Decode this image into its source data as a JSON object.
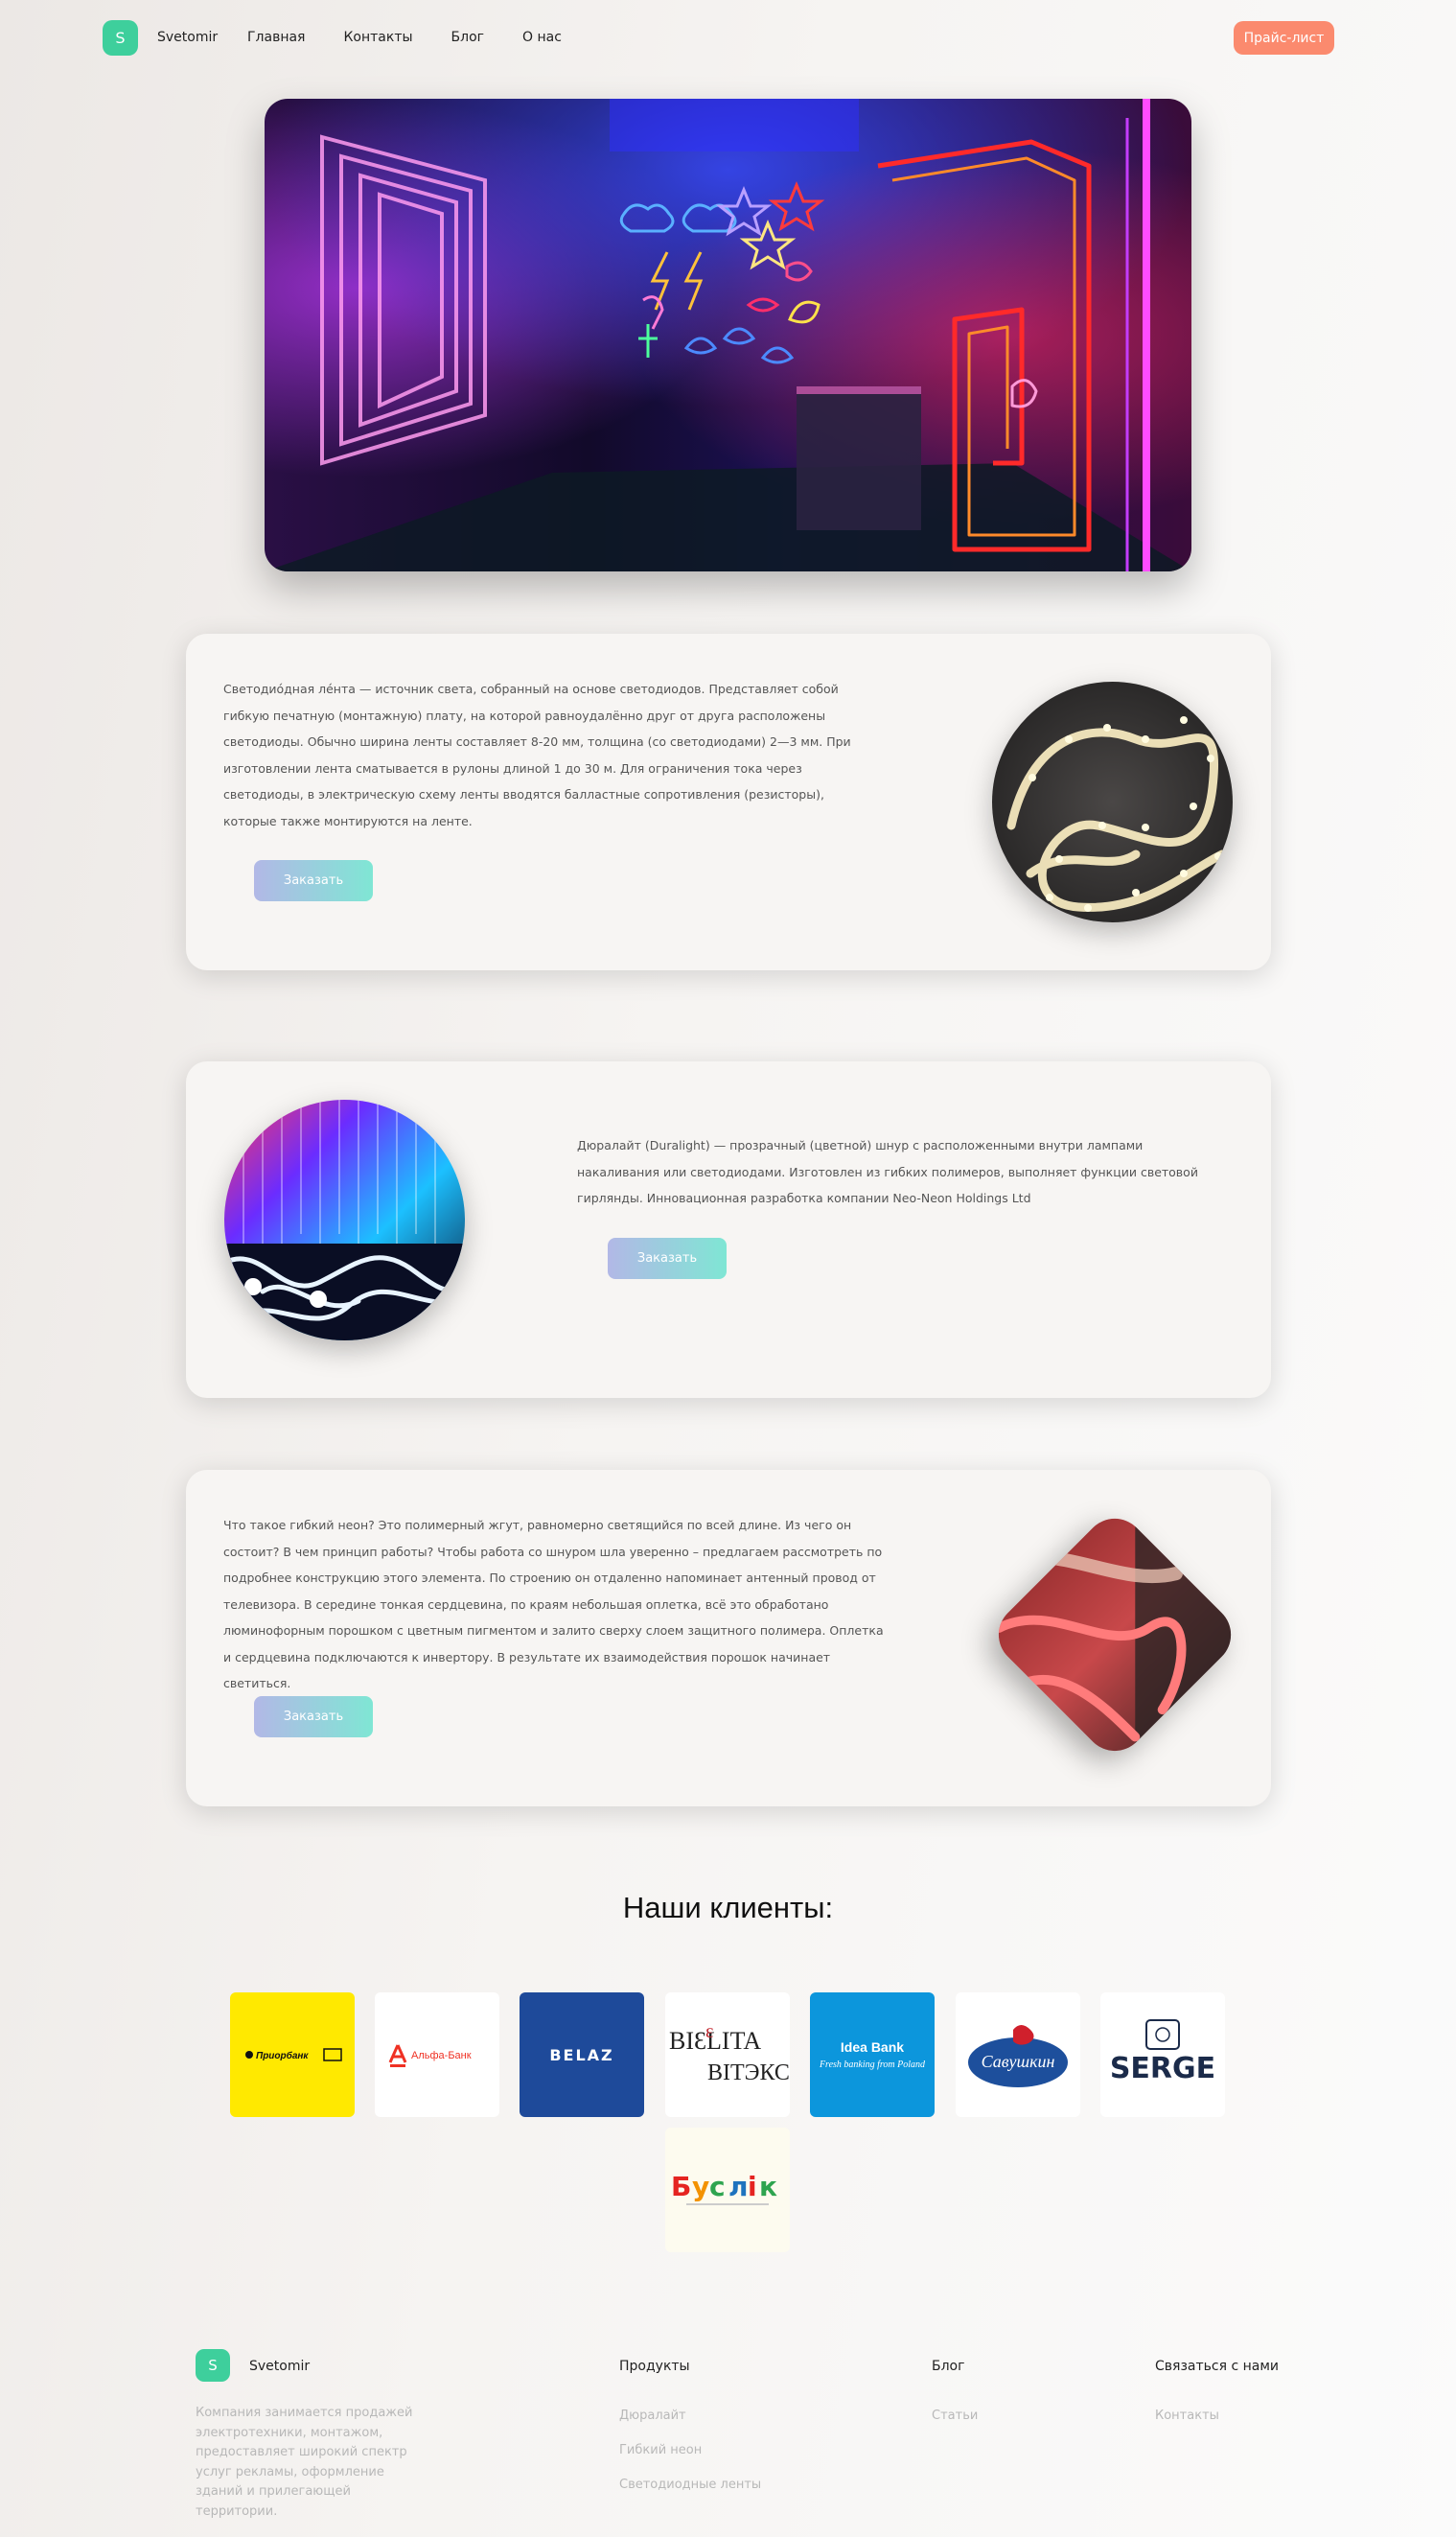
{
  "header": {
    "logo_letter": "S",
    "brand": "Svetomir",
    "nav": [
      "Главная",
      "Контакты",
      "Блог",
      "О нас"
    ],
    "price_button": "Прайс-лист"
  },
  "sections": [
    {
      "text": "Светодиóдная лéнта — источник света, собранный на основе светодиодов. Представляет собой гибкую печатную (монтажную) плату, на которой равноудалённо друг от друга расположены светодиоды. Обычно ширина ленты составляет 8-20 мм, толщина (со светодиодами) 2—3 мм. При изготовлении лента сматывается в рулоны длиной 1 до 30 м. Для ограничения тока через светодиоды, в электрическую схему ленты вводятся балластные сопротивления (резисторы), которые также монтируются на ленте.",
      "button": "Заказать"
    },
    {
      "text": "Дюралайт (Duralight) — прозрачный (цветной) шнур с расположенными внутри лампами накаливания или светодиодами. Изготовлен из гибких полимеров, выполняет функции световой гирлянды. Инновационная разработка компании Neo-Neon Holdings Ltd",
      "button": "Заказать"
    },
    {
      "text": "Что такое гибкий неон? Это полимерный жгут, равномерно светящийся по всей длине. Из чего он состоит? В чем принцип работы? Чтобы работа со шнуром шла уверенно – предлагаем рассмотреть по подробнее конструкцию этого элемента. По строению он отдаленно напоминает антенный провод от телевизора. В середине тонкая сердцевина, по краям небольшая оплетка, всё это обработано люминофорным порошком с цветным пигментом и залито сверху слоем защитного полимера. Оплетка и сердцевина подключаются к инвертору. В результате их взаимодействия порошок начинает светиться.",
      "button": "Заказать"
    }
  ],
  "clients": {
    "title": "Наши клиенты:",
    "logos": [
      {
        "name": "Приорбанк",
        "text": "Приорбанк",
        "bg": "#ffe900"
      },
      {
        "name": "Альфа-Банк",
        "text": "Альфа-Банк",
        "bg": "#ffffff"
      },
      {
        "name": "BELAZ",
        "text": "BELAZ",
        "bg": "#1e4a9a"
      },
      {
        "name": "BIELITA ВІТЭКС",
        "text": "BIELITA",
        "text2": "ВІТЭКС",
        "bg": "#ffffff"
      },
      {
        "name": "Idea Bank",
        "text": "Idea Bank",
        "text2": "Fresh banking from Poland",
        "bg": "#0c96dc"
      },
      {
        "name": "Савушкин продукт",
        "text": "Савушкин",
        "bg": "#ffffff"
      },
      {
        "name": "SERGE",
        "text": "SERGE",
        "bg": "#ffffff"
      },
      {
        "name": "Буслік",
        "text": "Буслік",
        "bg": "#fdfbef"
      }
    ]
  },
  "footer": {
    "logo_letter": "S",
    "brand": "Svetomir",
    "about": "Компания занимается продажей электротехники, монтажом, предоставляет широкий спектр услуг рекламы, оформление зданий и прилегающей территории.",
    "columns": [
      {
        "title": "Продукты",
        "links": [
          "Дюралайт",
          "Гибкий неон",
          "Светодиодные ленты"
        ]
      },
      {
        "title": "Блог",
        "links": [
          "Статьи"
        ]
      },
      {
        "title": "Связаться с нами",
        "links": [
          "Контакты"
        ]
      }
    ]
  },
  "colors": {
    "accent_green": "#3ecf9c",
    "price_button": "#fb8a6e",
    "order_gradient_start": "#b2b8e6",
    "order_gradient_end": "#7fe6d4"
  }
}
